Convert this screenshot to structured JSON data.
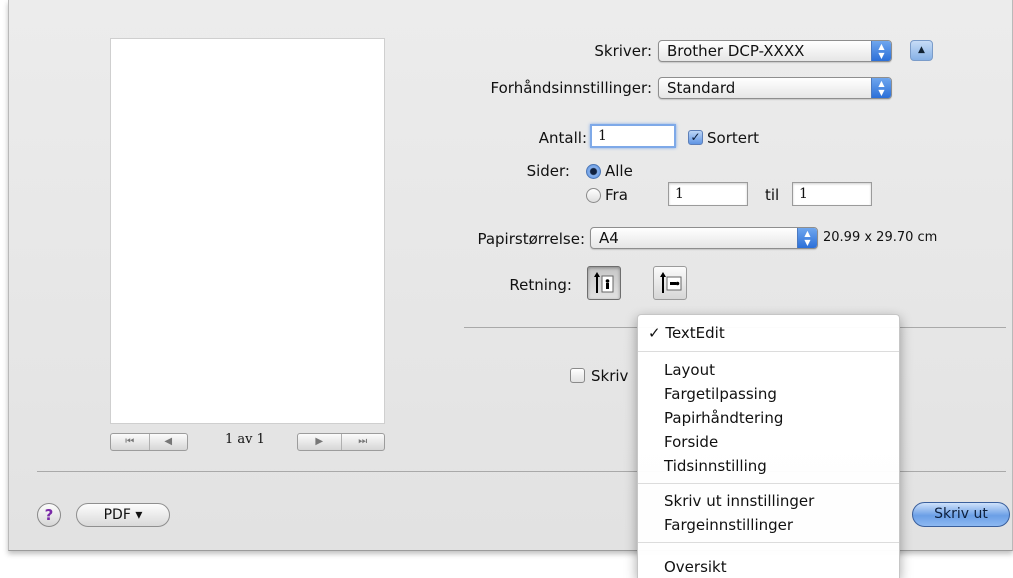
{
  "preview": {
    "pager": {
      "first": "⏮",
      "prev": "◀",
      "next": "▶",
      "last": "⏭",
      "page_label": "1 av 1"
    }
  },
  "printer": {
    "label": "Skriver:",
    "value": "Brother DCP-XXXX",
    "disclosure": "▲"
  },
  "presets": {
    "label": "Forhåndsinnstillinger:",
    "value": "Standard"
  },
  "copies": {
    "label": "Antall:",
    "value": "1",
    "collate_label": "Sortert",
    "collate_checked": true
  },
  "pages": {
    "label": "Sider:",
    "all_label": "Alle",
    "from_label": "Fra",
    "from_value": "1",
    "to_label": "til",
    "to_value": "1",
    "selected": "all"
  },
  "paper_size": {
    "label": "Papirstørrelse:",
    "value": "A4",
    "dimensions": "20.99 x 29.70 cm"
  },
  "orientation": {
    "label": "Retning:",
    "selected": "portrait"
  },
  "app_menu": {
    "checked_item": "TextEdit",
    "group1": [
      "Layout",
      "Fargetilpassing",
      "Papirhåndtering",
      "Forside",
      "Tidsinnstilling"
    ],
    "group2": [
      "Skriv ut innstillinger",
      "Fargeinnstillinger"
    ],
    "group3": [
      "Oversikt"
    ]
  },
  "behind_menu": {
    "checkbox_partial_label": "Skriv"
  },
  "bottom": {
    "help": "?",
    "pdf_label": "PDF ▾",
    "print_label": "Skriv ut"
  },
  "colors": {
    "accent": "#2b6fd8",
    "help_icon": "#7a2aa8"
  }
}
